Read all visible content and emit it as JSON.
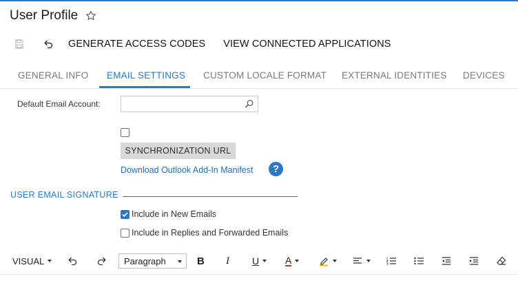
{
  "page": {
    "title": "User Profile"
  },
  "toolbar": {
    "generate_label": "GENERATE ACCESS CODES",
    "view_label": "VIEW CONNECTED APPLICATIONS"
  },
  "tabs": [
    {
      "label": "GENERAL INFO",
      "active": false
    },
    {
      "label": "EMAIL SETTINGS",
      "active": true
    },
    {
      "label": "CUSTOM LOCALE FORMAT",
      "active": false
    },
    {
      "label": "EXTERNAL IDENTITIES",
      "active": false
    },
    {
      "label": "DEVICES",
      "active": false
    }
  ],
  "email_settings": {
    "default_account_label": "Default Email Account:",
    "default_account_value": "",
    "sync_checkbox_checked": false,
    "sync_button_label": "SYNCHRONIZATION URL",
    "download_link": "Download Outlook Add-In Manifest",
    "help_glyph": "?"
  },
  "signature": {
    "section_title": "USER EMAIL SIGNATURE",
    "include_new_label": "Include in New Emails",
    "include_new_checked": true,
    "include_replies_label": "Include in Replies and Forwarded Emails",
    "include_replies_checked": false
  },
  "editor": {
    "mode_label": "VISUAL",
    "paragraph_value": "Paragraph",
    "bold_glyph": "B",
    "italic_glyph": "I",
    "underline_glyph": "U",
    "font_color_glyph": "A"
  },
  "colors": {
    "accent": "#2b78c5",
    "font_color_bar": "#d32f2f"
  },
  "icons": [
    "star-icon",
    "save-icon",
    "undo-icon",
    "search-icon",
    "help-icon",
    "redo-icon",
    "highlight-icon",
    "align-icon",
    "numbered-list-icon",
    "bullet-list-icon",
    "outdent-icon",
    "indent-icon",
    "eraser-icon"
  ]
}
